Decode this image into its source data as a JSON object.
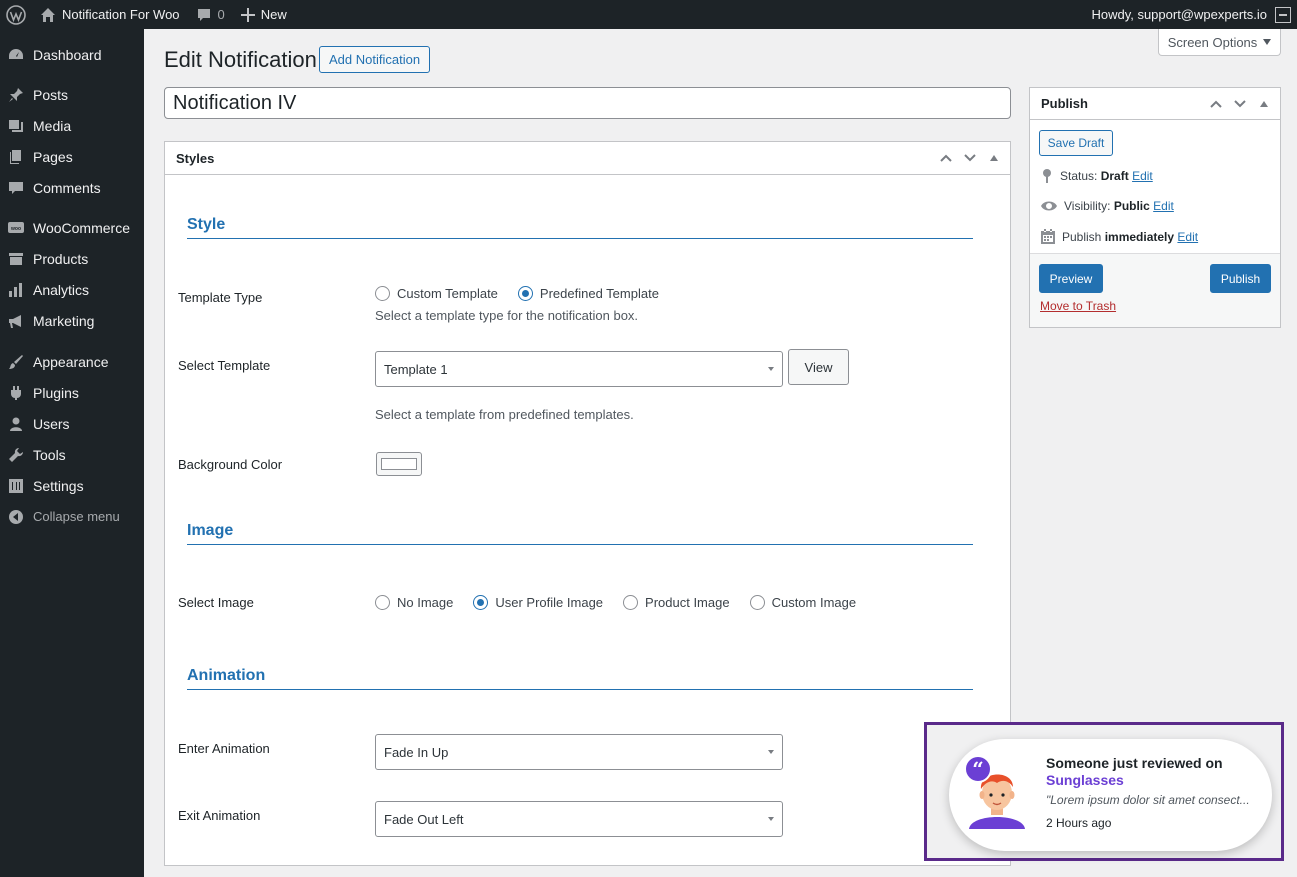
{
  "adminbar": {
    "site_name": "Notification For Woo",
    "comments_count": "0",
    "new_label": "New",
    "howdy": "Howdy, support@wpexperts.io"
  },
  "sidebar": {
    "items": [
      {
        "label": "Dashboard",
        "icon": "dashboard-icon"
      },
      {
        "label": "Posts",
        "icon": "pin-icon"
      },
      {
        "label": "Media",
        "icon": "media-icon"
      },
      {
        "label": "Pages",
        "icon": "pages-icon"
      },
      {
        "label": "Comments",
        "icon": "comment-icon"
      },
      {
        "label": "WooCommerce",
        "icon": "woo-icon"
      },
      {
        "label": "Products",
        "icon": "archive-icon"
      },
      {
        "label": "Analytics",
        "icon": "bar-chart-icon"
      },
      {
        "label": "Marketing",
        "icon": "megaphone-icon"
      },
      {
        "label": "Appearance",
        "icon": "brush-icon"
      },
      {
        "label": "Plugins",
        "icon": "plugin-icon"
      },
      {
        "label": "Users",
        "icon": "users-icon"
      },
      {
        "label": "Tools",
        "icon": "wrench-icon"
      },
      {
        "label": "Settings",
        "icon": "settings-icon"
      }
    ],
    "collapse_label": "Collapse menu"
  },
  "header": {
    "screen_options": "Screen Options",
    "page_title": "Edit Notification",
    "add_button": "Add Notification",
    "post_title": "Notification IV"
  },
  "styles_box": {
    "title": "Styles",
    "style_heading": "Style",
    "template_type_label": "Template Type",
    "template_type_options": [
      "Custom Template",
      "Predefined Template"
    ],
    "template_type_selected": "Predefined Template",
    "template_type_desc": "Select a template type for the notification box.",
    "select_template_label": "Select Template",
    "select_template_value": "Template 1",
    "view_button": "View",
    "select_template_desc": "Select a template from predefined templates.",
    "background_color_label": "Background Color",
    "background_color": "#ffffff",
    "image_heading": "Image",
    "select_image_label": "Select Image",
    "image_options": [
      "No Image",
      "User Profile Image",
      "Product Image",
      "Custom Image"
    ],
    "image_selected": "User Profile Image",
    "animation_heading": "Animation",
    "enter_animation_label": "Enter Animation",
    "enter_animation_value": "Fade In Up",
    "exit_animation_label": "Exit Animation",
    "exit_animation_value": "Fade Out Left"
  },
  "publish": {
    "title": "Publish",
    "save_draft": "Save Draft",
    "status_label": "Status:",
    "status_value": "Draft",
    "visibility_label": "Visibility:",
    "visibility_value": "Public",
    "publish_label": "Publish",
    "publish_value": "immediately",
    "edit_link": "Edit",
    "preview": "Preview",
    "publish_button": "Publish",
    "trash": "Move to Trash"
  },
  "notification": {
    "title": "Someone just reviewed on",
    "product": "Sunglasses",
    "quote": "\"Lorem ipsum dolor sit amet consect...",
    "time": "2 Hours ago",
    "accent_color": "#6b3fd4",
    "frame_color": "#5a2a8a"
  }
}
